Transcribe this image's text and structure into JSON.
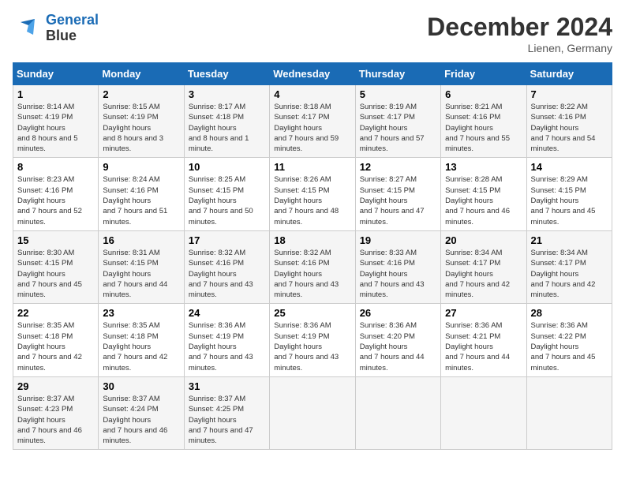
{
  "header": {
    "logo_line1": "General",
    "logo_line2": "Blue",
    "month_title": "December 2024",
    "location": "Lienen, Germany"
  },
  "days_of_week": [
    "Sunday",
    "Monday",
    "Tuesday",
    "Wednesday",
    "Thursday",
    "Friday",
    "Saturday"
  ],
  "weeks": [
    [
      {
        "day": "1",
        "sunrise": "8:14 AM",
        "sunset": "4:19 PM",
        "daylight": "8 hours and 5 minutes."
      },
      {
        "day": "2",
        "sunrise": "8:15 AM",
        "sunset": "4:19 PM",
        "daylight": "8 hours and 3 minutes."
      },
      {
        "day": "3",
        "sunrise": "8:17 AM",
        "sunset": "4:18 PM",
        "daylight": "8 hours and 1 minute."
      },
      {
        "day": "4",
        "sunrise": "8:18 AM",
        "sunset": "4:17 PM",
        "daylight": "7 hours and 59 minutes."
      },
      {
        "day": "5",
        "sunrise": "8:19 AM",
        "sunset": "4:17 PM",
        "daylight": "7 hours and 57 minutes."
      },
      {
        "day": "6",
        "sunrise": "8:21 AM",
        "sunset": "4:16 PM",
        "daylight": "7 hours and 55 minutes."
      },
      {
        "day": "7",
        "sunrise": "8:22 AM",
        "sunset": "4:16 PM",
        "daylight": "7 hours and 54 minutes."
      }
    ],
    [
      {
        "day": "8",
        "sunrise": "8:23 AM",
        "sunset": "4:16 PM",
        "daylight": "7 hours and 52 minutes."
      },
      {
        "day": "9",
        "sunrise": "8:24 AM",
        "sunset": "4:16 PM",
        "daylight": "7 hours and 51 minutes."
      },
      {
        "day": "10",
        "sunrise": "8:25 AM",
        "sunset": "4:15 PM",
        "daylight": "7 hours and 50 minutes."
      },
      {
        "day": "11",
        "sunrise": "8:26 AM",
        "sunset": "4:15 PM",
        "daylight": "7 hours and 48 minutes."
      },
      {
        "day": "12",
        "sunrise": "8:27 AM",
        "sunset": "4:15 PM",
        "daylight": "7 hours and 47 minutes."
      },
      {
        "day": "13",
        "sunrise": "8:28 AM",
        "sunset": "4:15 PM",
        "daylight": "7 hours and 46 minutes."
      },
      {
        "day": "14",
        "sunrise": "8:29 AM",
        "sunset": "4:15 PM",
        "daylight": "7 hours and 45 minutes."
      }
    ],
    [
      {
        "day": "15",
        "sunrise": "8:30 AM",
        "sunset": "4:15 PM",
        "daylight": "7 hours and 45 minutes."
      },
      {
        "day": "16",
        "sunrise": "8:31 AM",
        "sunset": "4:15 PM",
        "daylight": "7 hours and 44 minutes."
      },
      {
        "day": "17",
        "sunrise": "8:32 AM",
        "sunset": "4:16 PM",
        "daylight": "7 hours and 43 minutes."
      },
      {
        "day": "18",
        "sunrise": "8:32 AM",
        "sunset": "4:16 PM",
        "daylight": "7 hours and 43 minutes."
      },
      {
        "day": "19",
        "sunrise": "8:33 AM",
        "sunset": "4:16 PM",
        "daylight": "7 hours and 43 minutes."
      },
      {
        "day": "20",
        "sunrise": "8:34 AM",
        "sunset": "4:17 PM",
        "daylight": "7 hours and 42 minutes."
      },
      {
        "day": "21",
        "sunrise": "8:34 AM",
        "sunset": "4:17 PM",
        "daylight": "7 hours and 42 minutes."
      }
    ],
    [
      {
        "day": "22",
        "sunrise": "8:35 AM",
        "sunset": "4:18 PM",
        "daylight": "7 hours and 42 minutes."
      },
      {
        "day": "23",
        "sunrise": "8:35 AM",
        "sunset": "4:18 PM",
        "daylight": "7 hours and 42 minutes."
      },
      {
        "day": "24",
        "sunrise": "8:36 AM",
        "sunset": "4:19 PM",
        "daylight": "7 hours and 43 minutes."
      },
      {
        "day": "25",
        "sunrise": "8:36 AM",
        "sunset": "4:19 PM",
        "daylight": "7 hours and 43 minutes."
      },
      {
        "day": "26",
        "sunrise": "8:36 AM",
        "sunset": "4:20 PM",
        "daylight": "7 hours and 44 minutes."
      },
      {
        "day": "27",
        "sunrise": "8:36 AM",
        "sunset": "4:21 PM",
        "daylight": "7 hours and 44 minutes."
      },
      {
        "day": "28",
        "sunrise": "8:36 AM",
        "sunset": "4:22 PM",
        "daylight": "7 hours and 45 minutes."
      }
    ],
    [
      {
        "day": "29",
        "sunrise": "8:37 AM",
        "sunset": "4:23 PM",
        "daylight": "7 hours and 46 minutes."
      },
      {
        "day": "30",
        "sunrise": "8:37 AM",
        "sunset": "4:24 PM",
        "daylight": "7 hours and 46 minutes."
      },
      {
        "day": "31",
        "sunrise": "8:37 AM",
        "sunset": "4:25 PM",
        "daylight": "7 hours and 47 minutes."
      },
      null,
      null,
      null,
      null
    ]
  ]
}
